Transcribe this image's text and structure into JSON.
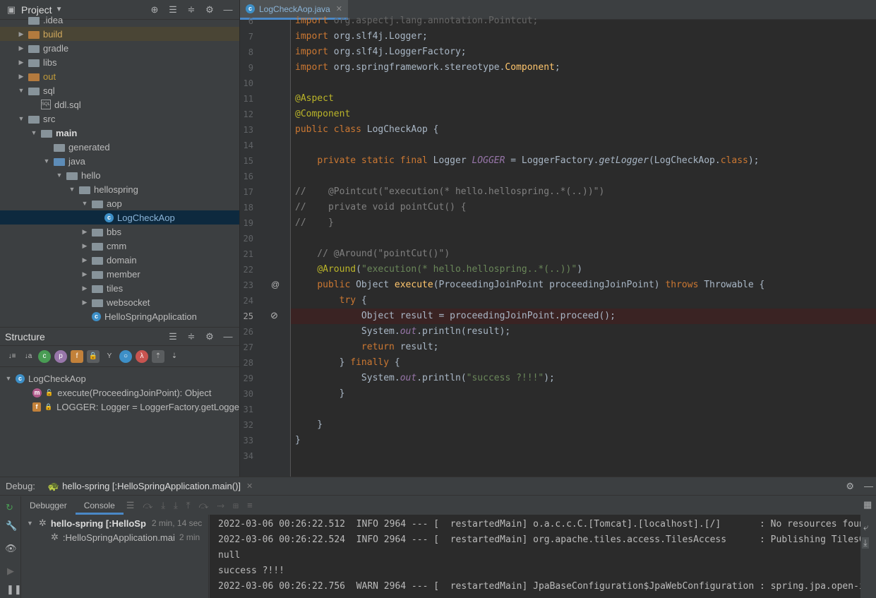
{
  "project_panel": {
    "title": "Project",
    "tree": [
      {
        "label": ".idea",
        "indent": 0,
        "arrow": "",
        "icon": "folder",
        "color": "#bbbbbb"
      },
      {
        "label": "build",
        "indent": 0,
        "arrow": "▶",
        "icon": "folder-orange",
        "color": "#d0a85c"
      },
      {
        "label": "gradle",
        "indent": 0,
        "arrow": "▶",
        "icon": "folder",
        "color": "#bbbbbb"
      },
      {
        "label": "libs",
        "indent": 0,
        "arrow": "▶",
        "icon": "folder",
        "color": "#bbbbbb"
      },
      {
        "label": "out",
        "indent": 0,
        "arrow": "▶",
        "icon": "folder-orange",
        "color": "#c09a3a"
      },
      {
        "label": "sql",
        "indent": 0,
        "arrow": "▼",
        "icon": "folder",
        "color": "#bbbbbb"
      },
      {
        "label": "ddl.sql",
        "indent": 1,
        "arrow": "",
        "icon": "sql",
        "color": "#bbbbbb"
      },
      {
        "label": "src",
        "indent": 0,
        "arrow": "▼",
        "icon": "folder",
        "color": "#bbbbbb"
      },
      {
        "label": "main",
        "indent": 1,
        "arrow": "▼",
        "icon": "folder",
        "color": "#dcdcdc"
      },
      {
        "label": "generated",
        "indent": 2,
        "arrow": "",
        "icon": "folder",
        "color": "#bbbbbb"
      },
      {
        "label": "java",
        "indent": 2,
        "arrow": "▼",
        "icon": "folder-blue",
        "color": "#bbbbbb"
      },
      {
        "label": "hello",
        "indent": 3,
        "arrow": "▼",
        "icon": "folder",
        "color": "#bbbbbb"
      },
      {
        "label": "hellospring",
        "indent": 4,
        "arrow": "▼",
        "icon": "folder",
        "color": "#bbbbbb"
      },
      {
        "label": "aop",
        "indent": 5,
        "arrow": "▼",
        "icon": "folder",
        "color": "#bbbbbb"
      },
      {
        "label": "LogCheckAop",
        "indent": 6,
        "arrow": "",
        "icon": "class",
        "color": "#8ab4d8"
      },
      {
        "label": "bbs",
        "indent": 5,
        "arrow": "▶",
        "icon": "folder",
        "color": "#bbbbbb"
      },
      {
        "label": "cmm",
        "indent": 5,
        "arrow": "▶",
        "icon": "folder",
        "color": "#bbbbbb"
      },
      {
        "label": "domain",
        "indent": 5,
        "arrow": "▶",
        "icon": "folder",
        "color": "#bbbbbb"
      },
      {
        "label": "member",
        "indent": 5,
        "arrow": "▶",
        "icon": "folder",
        "color": "#bbbbbb"
      },
      {
        "label": "tiles",
        "indent": 5,
        "arrow": "▶",
        "icon": "folder",
        "color": "#bbbbbb"
      },
      {
        "label": "websocket",
        "indent": 5,
        "arrow": "▶",
        "icon": "folder",
        "color": "#bbbbbb"
      },
      {
        "label": "HelloSpringApplication",
        "indent": 5,
        "arrow": "",
        "icon": "class",
        "color": "#bbbbbb"
      }
    ]
  },
  "structure_panel": {
    "title": "Structure",
    "root": "LogCheckAop",
    "members": [
      {
        "badge": "m",
        "label": "execute(ProceedingJoinPoint): Object"
      },
      {
        "badge": "f",
        "label": "LOGGER: Logger = LoggerFactory.getLogge"
      }
    ]
  },
  "editor": {
    "tab_label": "LogCheckAop.java",
    "line_numbers": [
      "6",
      "7",
      "8",
      "9",
      "10",
      "11",
      "12",
      "13",
      "14",
      "15",
      "16",
      "17",
      "18",
      "19",
      "20",
      "21",
      "22",
      "23",
      "24",
      "25",
      "26",
      "27",
      "28",
      "29",
      "30",
      "31",
      "32",
      "33",
      "34"
    ]
  },
  "debug": {
    "label": "Debug:",
    "session_tab": "hello-spring [:HelloSpringApplication.main()]",
    "tabs": [
      "Debugger",
      "Console"
    ],
    "frames": [
      {
        "label": "hello-spring [:HelloSp",
        "time": "2 min, 14 sec"
      },
      {
        "label": ":HelloSpringApplication.mai",
        "time": "2 min"
      }
    ],
    "console_lines": [
      "success ?!!!",
      "2022-03-06 00:26:22.512  INFO 2964 --- [  restartedMain] o.a.c.c.C.[Tomcat].[localhost].[/]       : No resources found",
      "2022-03-06 00:26:22.524  INFO 2964 --- [  restartedMain] org.apache.tiles.access.TilesAccess      : Publishing TilesC",
      "null",
      "success ?!!!",
      "2022-03-06 00:26:22.756  WARN 2964 --- [  restartedMain] JpaBaseConfiguration$JpaWebConfiguration : spring.jpa.open-i"
    ]
  },
  "colors": {
    "accent": "#4a88c7",
    "keyword": "#cc7832",
    "annotation": "#bbb529",
    "string": "#6a8759",
    "comment": "#808080"
  }
}
